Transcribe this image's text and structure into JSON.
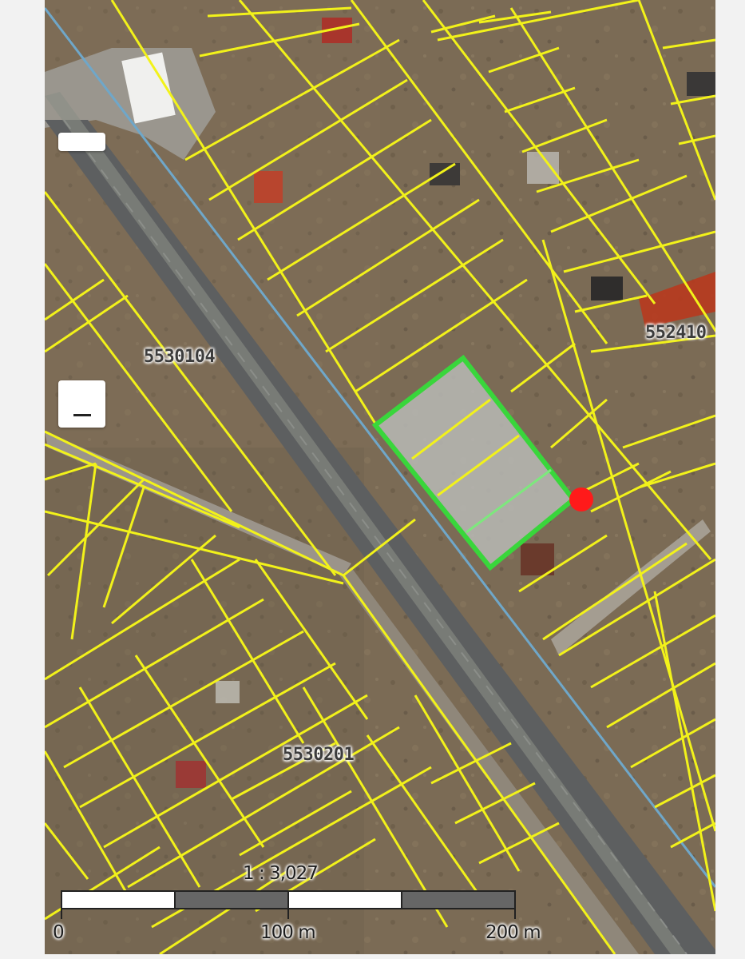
{
  "map": {
    "parcel_labels": [
      "5530104",
      "552410",
      "5530201"
    ],
    "scale_ratio": "1 : 3,027",
    "scale_labels": [
      "0",
      "100 m",
      "200 m"
    ],
    "colors": {
      "parcel_line": "#f2f21a",
      "selected_parcel": "#39d63b",
      "marker": "#ff1a1a",
      "highlight_parcel": "#b83a1e"
    }
  },
  "controls": {
    "zoom_in": {
      "icon": "plus-icon"
    },
    "zoom_out": {
      "icon": "minus-icon"
    }
  }
}
